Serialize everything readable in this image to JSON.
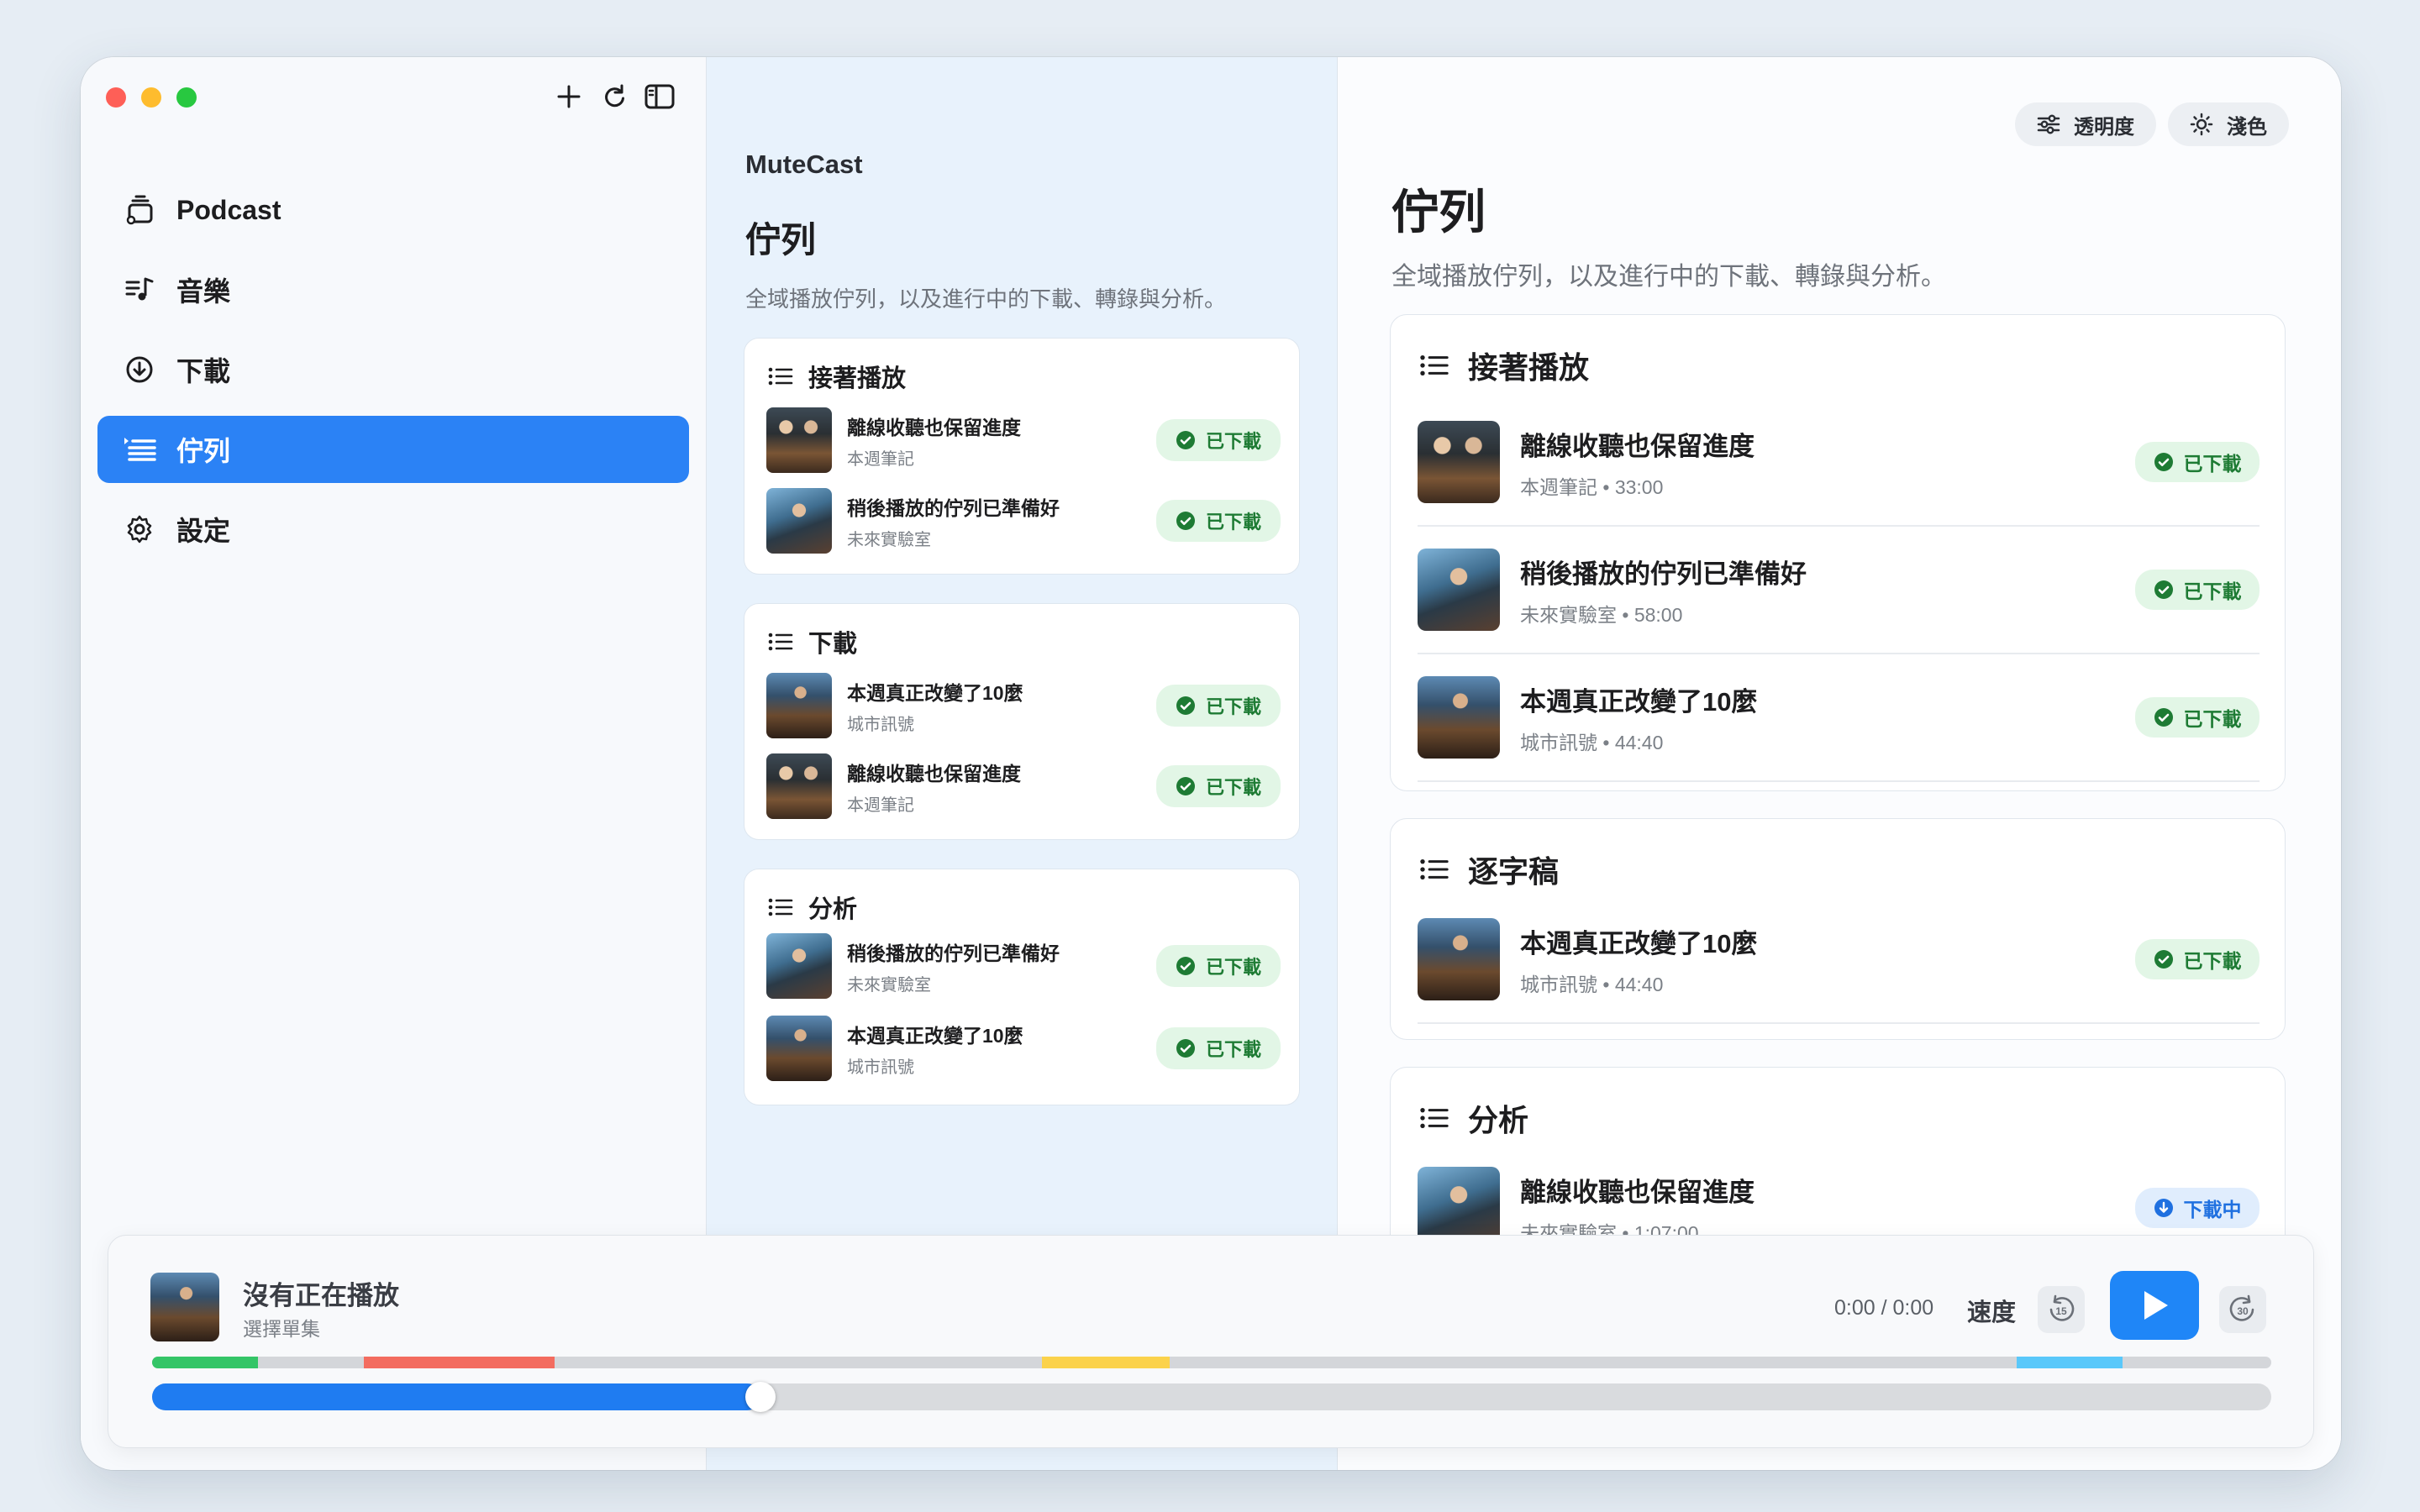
{
  "window_controls": {
    "close": "close",
    "minimize": "minimize",
    "zoom": "zoom"
  },
  "sidebar": {
    "tools": [
      "plus-icon",
      "refresh-icon",
      "sidebar-toggle-icon"
    ],
    "items": [
      {
        "label": "Podcast",
        "icon": "podcast-stack-icon",
        "active": false
      },
      {
        "label": "音樂",
        "icon": "music-list-icon",
        "active": false
      },
      {
        "label": "下載",
        "icon": "download-circle-icon",
        "active": false
      },
      {
        "label": "佇列",
        "icon": "queue-list-icon",
        "active": true
      },
      {
        "label": "設定",
        "icon": "gear-icon",
        "active": false
      }
    ]
  },
  "middle": {
    "app_name": "MuteCast",
    "title": "佇列",
    "subtitle": "全域播放佇列，以及進行中的下載、轉錄與分析。",
    "sections": [
      {
        "title": "接著播放",
        "rows": [
          {
            "title": "離線收聽也保留進度",
            "show": "本週筆記",
            "status": "已下載"
          },
          {
            "title": "稍後播放的佇列已準備好",
            "show": "未來實驗室",
            "status": "已下載"
          }
        ]
      },
      {
        "title": "下載",
        "rows": [
          {
            "title": "本週真正改變了10麼",
            "show": "城市訊號",
            "status": "已下載"
          },
          {
            "title": "離線收聽也保留進度",
            "show": "本週筆記",
            "status": "已下載"
          }
        ]
      },
      {
        "title": "分析",
        "rows": [
          {
            "title": "稍後播放的佇列已準備好",
            "show": "未來實驗室",
            "status": "已下載"
          },
          {
            "title": "本週真正改變了10麼",
            "show": "城市訊號",
            "status": "已下載"
          }
        ]
      }
    ]
  },
  "right": {
    "buttons": {
      "transparency": "透明度",
      "theme": "淺色"
    },
    "title": "佇列",
    "subtitle": "全域播放佇列，以及進行中的下載、轉錄與分析。",
    "sections": [
      {
        "title": "接著播放",
        "rows": [
          {
            "title": "離線收聽也保留進度",
            "meta": "本週筆記 • 33:00",
            "status": "已下載",
            "status_kind": "green"
          },
          {
            "title": "稍後播放的佇列已準備好",
            "meta": "未來實驗室 • 58:00",
            "status": "已下載",
            "status_kind": "green"
          },
          {
            "title": "本週真正改變了10麼",
            "meta": "城市訊號 • 44:40",
            "status": "已下載",
            "status_kind": "green"
          }
        ]
      },
      {
        "title": "逐字稿",
        "rows": [
          {
            "title": "本週真正改變了10麼",
            "meta": "城市訊號 • 44:40",
            "status": "已下載",
            "status_kind": "green"
          }
        ]
      },
      {
        "title": "分析",
        "rows": [
          {
            "title": "離線收聽也保留進度",
            "meta": "未來實驗室 • 1:07:00",
            "status": "下載中",
            "status_kind": "blue"
          }
        ]
      }
    ]
  },
  "player": {
    "title": "沒有正在播放",
    "subtitle": "選擇單集",
    "time": "0:00 / 0:00",
    "speed_label": "速度",
    "skip_back": "15",
    "skip_forward": "30",
    "progress": 0.28,
    "segments": [
      {
        "start": 0.0,
        "end": 0.05,
        "color": "#34c567"
      },
      {
        "start": 0.1,
        "end": 0.19,
        "color": "#f36c5f"
      },
      {
        "start": 0.42,
        "end": 0.48,
        "color": "#fbd24b"
      },
      {
        "start": 0.88,
        "end": 0.93,
        "color": "#5ac8fa"
      }
    ]
  },
  "colors": {
    "accent": "#2b82f5",
    "downloaded": "#1e7b34",
    "downloading": "#1f70e0"
  }
}
